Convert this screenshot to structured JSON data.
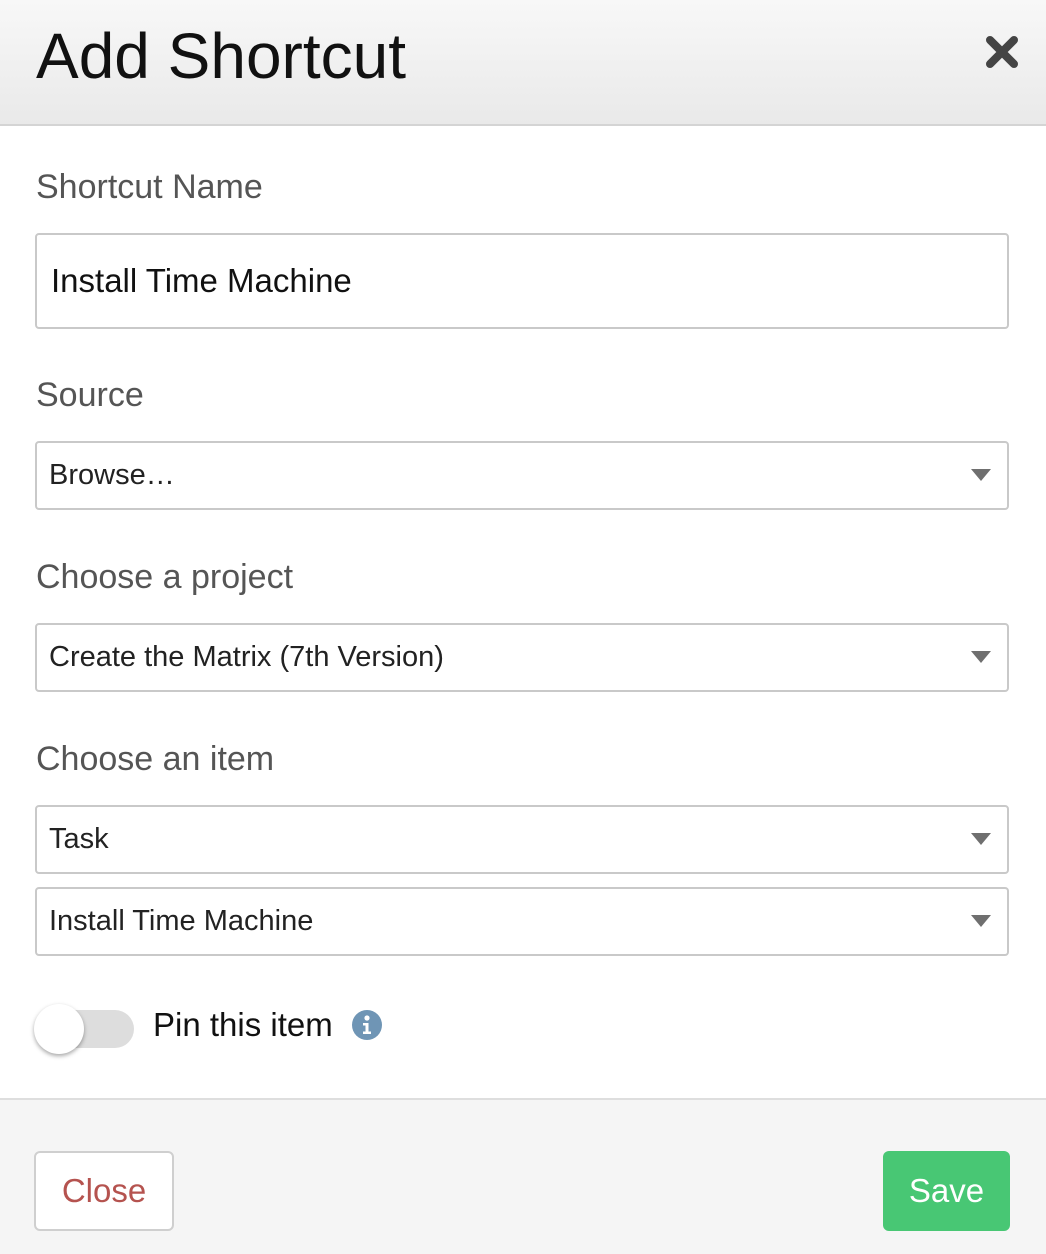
{
  "modal": {
    "title": "Add Shortcut",
    "close_icon": "close-icon"
  },
  "form": {
    "shortcut_name": {
      "label": "Shortcut Name",
      "value": "Install Time Machine"
    },
    "source": {
      "label": "Source",
      "selected": "Browse…"
    },
    "project": {
      "label": "Choose a project",
      "selected": "Create the Matrix (7th Version)"
    },
    "item": {
      "label": "Choose an item",
      "type_selected": "Task",
      "item_selected": "Install Time Machine"
    },
    "pin": {
      "label": "Pin this item",
      "enabled": false,
      "info_icon": "info-icon"
    }
  },
  "footer": {
    "close_label": "Close",
    "save_label": "Save"
  },
  "colors": {
    "save_button": "#48c774",
    "close_text": "#b5534f",
    "info_icon": "#6f95b5",
    "toggle_track": "#dddddd"
  }
}
